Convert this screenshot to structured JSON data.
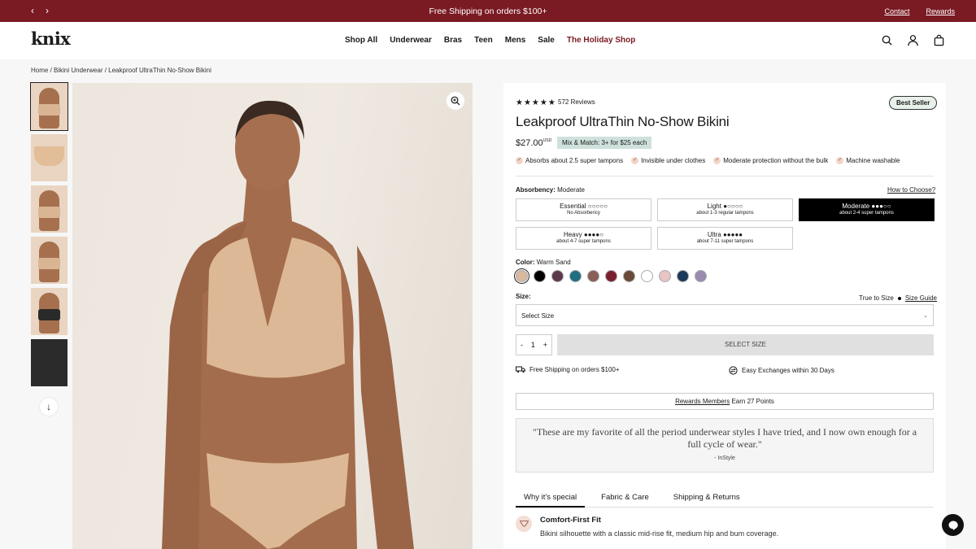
{
  "topbar": {
    "prev_label": "‹",
    "next_label": "›",
    "promo": "Free Shipping on orders $100+",
    "contact": "Contact",
    "rewards": "Rewards"
  },
  "header": {
    "logo": "knix",
    "nav": [
      "Shop All",
      "Underwear",
      "Bras",
      "Teen",
      "Mens",
      "Sale",
      "The Holiday Shop"
    ],
    "icons": [
      "search-icon",
      "account-icon",
      "cart-icon"
    ]
  },
  "breadcrumb": {
    "home": "Home",
    "sep1": " / ",
    "category": "Bikini Underwear",
    "sep2": " / ",
    "current": "Leakproof UltraThin No-Show Bikini"
  },
  "gallery": {
    "thumb_count": 6,
    "down_label": "↓"
  },
  "product": {
    "stars": "★★★★★",
    "rating": 4.5,
    "reviews": "572 Reviews",
    "badge": "Best Seller",
    "title": "Leakproof UltraThin No-Show Bikini",
    "price": "$27.00",
    "currency": "USD",
    "promo": "Mix & Match: 3+ for $25 each",
    "features": [
      "Absorbs about 2.5 super tampons",
      "Invisible under clothes",
      "Moderate protection without the bulk",
      "Machine washable"
    ],
    "absorbency_label": "Absorbency:",
    "absorbency_value": "Moderate",
    "how_to": "How to Choose?",
    "absorbency_options": [
      {
        "name": "Essential",
        "drops": "○○○○○",
        "sub": "No Absorbency"
      },
      {
        "name": "Light",
        "drops": "●○○○○",
        "sub": "about 1-3 regular tampons"
      },
      {
        "name": "Moderate",
        "drops": "●●●○○",
        "sub": "about 2-4 super tampons"
      },
      {
        "name": "Heavy",
        "drops": "●●●●○",
        "sub": "about 4-7 super tampons"
      },
      {
        "name": "Ultra",
        "drops": "●●●●●",
        "sub": "about 7-11 super tampons"
      }
    ],
    "selected_absorbency": "Moderate",
    "color_label": "Color:",
    "color_value": "Warm Sand",
    "swatches": [
      "#d9b99e",
      "#000000",
      "#5a3a4a",
      "#1f6f80",
      "#8a5f58",
      "#7a1f2e",
      "#6a4a3a",
      "#ffffff",
      "#e8c4c4",
      "#1e3a5a",
      "#9a8ab0"
    ],
    "size_label": "Size:",
    "true_to_size": "True to Size",
    "size_guide": "Size Guide",
    "size_select": "Select Size",
    "qty": "1",
    "qty_minus": "-",
    "qty_plus": "+",
    "add_button": "SELECT SIZE",
    "shipping": "Free Shipping on orders $100+",
    "exchanges": "Easy Exchanges within 30 Days",
    "rewards_link": "Rewards Members",
    "rewards_text": " Earn 27 Points",
    "quote": "\"These are my favorite of all the period underwear styles I have tried, and I now own enough for a full cycle of wear.\"",
    "quote_author": "- InStyle",
    "tabs": [
      "Why it's special",
      "Fabric & Care",
      "Shipping & Returns"
    ],
    "feature_title": "Comfort-First Fit",
    "feature_desc": "Bikini silhouette with a classic mid-rise fit, medium hip and bum coverage."
  },
  "colors": {
    "topbar_bg": "#7a1a22",
    "holiday": "#7a1a22",
    "promo_bg": "#cfe1dc",
    "selected_option": "#000000"
  }
}
